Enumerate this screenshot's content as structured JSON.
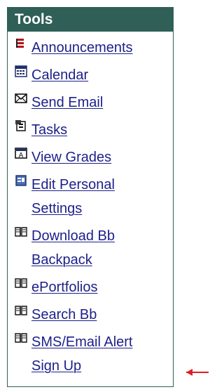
{
  "tools": {
    "title": "Tools",
    "items": [
      {
        "label": "Announcements",
        "icon": "announcement-icon"
      },
      {
        "label": "Calendar",
        "icon": "calendar-icon"
      },
      {
        "label": "Send Email",
        "icon": "email-icon"
      },
      {
        "label": "Tasks",
        "icon": "tasks-icon"
      },
      {
        "label": "View Grades",
        "icon": "grades-icon"
      },
      {
        "label": "Edit Personal Settings",
        "icon": "settings-icon"
      },
      {
        "label": "Download Bb Backpack",
        "icon": "book-icon"
      },
      {
        "label": "ePortfolios",
        "icon": "book-icon"
      },
      {
        "label": "Search Bb",
        "icon": "book-icon"
      },
      {
        "label": "SMS/Email Alert Sign Up",
        "icon": "book-icon"
      }
    ]
  },
  "colors": {
    "header": "#2f5f56",
    "link": "#1c1f8a",
    "arrow": "#e01c24"
  }
}
